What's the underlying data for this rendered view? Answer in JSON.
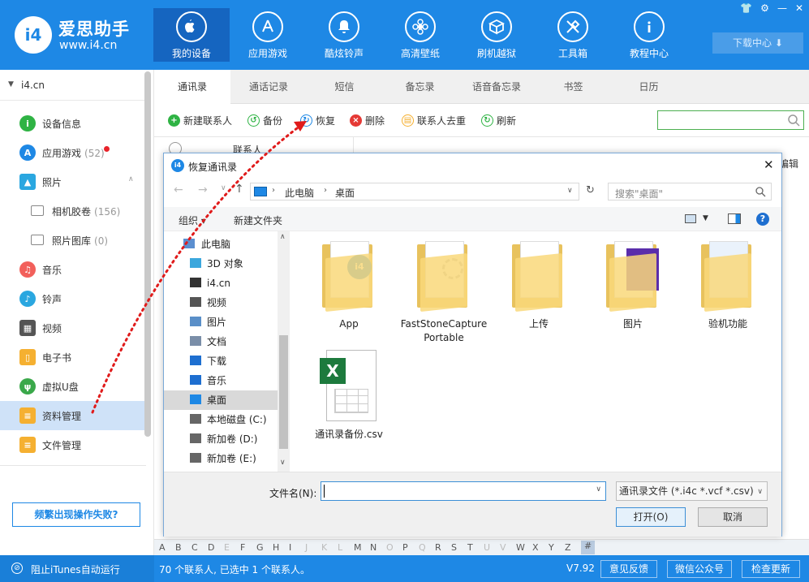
{
  "app": {
    "name": "爱思助手",
    "url": "www.i4.cn"
  },
  "nav": [
    {
      "label": "我的设备",
      "icon": "apple-icon",
      "active": true
    },
    {
      "label": "应用游戏",
      "icon": "app-store-icon"
    },
    {
      "label": "酷炫铃声",
      "icon": "bell-icon"
    },
    {
      "label": "高清壁纸",
      "icon": "flower-icon"
    },
    {
      "label": "刷机越狱",
      "icon": "box-icon"
    },
    {
      "label": "工具箱",
      "icon": "tools-icon"
    },
    {
      "label": "教程中心",
      "icon": "info-icon"
    }
  ],
  "download_label": "下载中心",
  "sidebar": {
    "device": "i4.cn",
    "items": [
      {
        "label": "设备信息",
        "icon": "info-icon",
        "color": "#2fb344"
      },
      {
        "label": "应用游戏",
        "count": "(52)",
        "icon": "app-store-icon",
        "color": "#1e88e5"
      },
      {
        "label": "照片",
        "icon": "photo-icon",
        "color": "#2aa7e0"
      },
      {
        "label": "相机胶卷",
        "count": "(156)",
        "icon": "camera-roll-icon"
      },
      {
        "label": "照片图库",
        "count": "(0)",
        "icon": "folder-icon"
      },
      {
        "label": "音乐",
        "icon": "music-icon",
        "color": "#f2605b"
      },
      {
        "label": "铃声",
        "icon": "bell-icon",
        "color": "#2aa7e0"
      },
      {
        "label": "视频",
        "icon": "film-icon",
        "color": "#555555"
      },
      {
        "label": "电子书",
        "icon": "book-icon",
        "color": "#f5b031"
      },
      {
        "label": "虚拟U盘",
        "icon": "usb-icon",
        "color": "#3aa84a"
      },
      {
        "label": "资料管理",
        "icon": "contacts-icon",
        "color": "#f5b031"
      },
      {
        "label": "文件管理",
        "icon": "file-icon",
        "color": "#f5b031"
      }
    ],
    "fail_label": "频繁出现操作失败?"
  },
  "tabs": [
    "通讯录",
    "通话记录",
    "短信",
    "备忘录",
    "语音备忘录",
    "书签",
    "日历"
  ],
  "toolbar": [
    "新建联系人",
    "备份",
    "恢复",
    "删除",
    "联系人去重",
    "刷新"
  ],
  "list_header": {
    "column": "联系人",
    "right_fragment": "编辑"
  },
  "alphabet": [
    "A",
    "B",
    "C",
    "D",
    "E",
    "F",
    "G",
    "H",
    "I",
    "J",
    "K",
    "L",
    "M",
    "N",
    "O",
    "P",
    "Q",
    "R",
    "S",
    "T",
    "U",
    "V",
    "W",
    "X",
    "Y",
    "Z",
    "#"
  ],
  "alphabet_dim": [
    "E",
    "J",
    "K",
    "L",
    "O",
    "Q",
    "U",
    "V"
  ],
  "status": {
    "itunes": "阻止iTunes自动运行",
    "summary": "70 个联系人, 已选中 1 个联系人。",
    "version": "V7.92",
    "feedback": "意见反馈",
    "wechat": "微信公众号",
    "update": "检查更新"
  },
  "dialog": {
    "title": "恢复通讯录",
    "path": [
      "此电脑",
      "桌面"
    ],
    "search_placeholder": "搜索\"桌面\"",
    "organize": "组织",
    "new_folder": "新建文件夹",
    "tree": [
      {
        "label": "此电脑",
        "icon": "computer-icon"
      },
      {
        "label": "3D 对象",
        "icon": "cube-icon"
      },
      {
        "label": "i4.cn",
        "icon": "phone-icon"
      },
      {
        "label": "视频",
        "icon": "video-icon"
      },
      {
        "label": "图片",
        "icon": "picture-icon"
      },
      {
        "label": "文档",
        "icon": "document-icon"
      },
      {
        "label": "下载",
        "icon": "download-icon"
      },
      {
        "label": "音乐",
        "icon": "music-icon"
      },
      {
        "label": "桌面",
        "icon": "desktop-icon",
        "selected": true
      },
      {
        "label": "本地磁盘 (C:)",
        "icon": "drive-icon"
      },
      {
        "label": "新加卷 (D:)",
        "icon": "drive-icon"
      },
      {
        "label": "新加卷 (E:)",
        "icon": "drive-icon"
      }
    ],
    "files": [
      {
        "label": "App",
        "type": "folder"
      },
      {
        "label": "FastStoneCapturePortable",
        "type": "folder"
      },
      {
        "label": "上传",
        "type": "folder"
      },
      {
        "label": "图片",
        "type": "folder"
      },
      {
        "label": "验机功能",
        "type": "folder"
      },
      {
        "label": "通讯录备份.csv",
        "type": "csv"
      }
    ],
    "filename_label": "文件名(N):",
    "filename_value": "",
    "filetype": "通讯录文件 (*.i4c *.vcf *.csv)",
    "open": "打开(O)",
    "cancel": "取消"
  }
}
